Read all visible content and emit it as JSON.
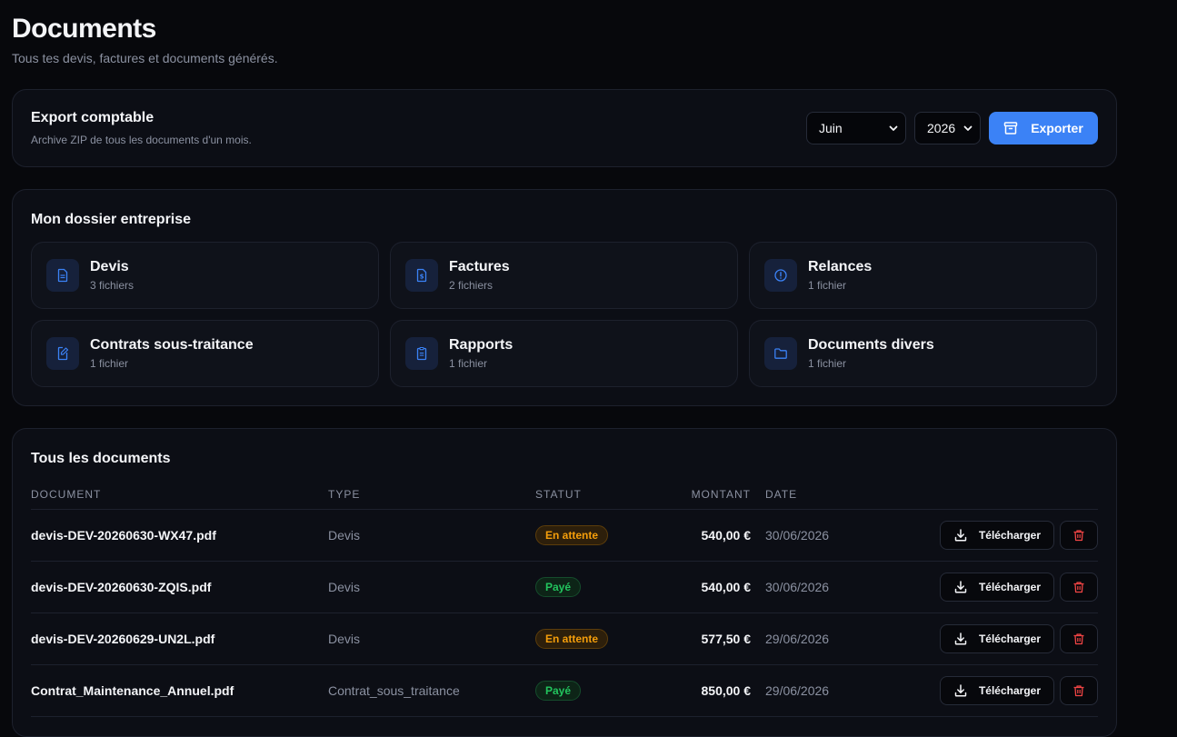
{
  "header": {
    "title": "Documents",
    "subtitle": "Tous tes devis, factures et documents générés."
  },
  "export": {
    "title": "Export comptable",
    "description": "Archive ZIP de tous les documents d'un mois.",
    "month": "Juin",
    "year": "2026",
    "button_label": "Exporter"
  },
  "folders": {
    "title": "Mon dossier entreprise",
    "items": [
      {
        "name": "Devis",
        "count": "3 fichiers",
        "icon": "file-text-icon"
      },
      {
        "name": "Factures",
        "count": "2 fichiers",
        "icon": "invoice-dollar-icon"
      },
      {
        "name": "Relances",
        "count": "1 fichier",
        "icon": "alert-circle-icon"
      },
      {
        "name": "Contrats sous-traitance",
        "count": "1 fichier",
        "icon": "file-edit-icon"
      },
      {
        "name": "Rapports",
        "count": "1 fichier",
        "icon": "clipboard-icon"
      },
      {
        "name": "Documents divers",
        "count": "1 fichier",
        "icon": "folder-icon"
      }
    ]
  },
  "documents": {
    "title": "Tous les documents",
    "columns": {
      "document": "DOCUMENT",
      "type": "TYPE",
      "status": "STATUT",
      "amount": "MONTANT",
      "date": "DATE"
    },
    "download_label": "Télécharger",
    "rows": [
      {
        "name": "devis-DEV-20260630-WX47.pdf",
        "type": "Devis",
        "status": "En attente",
        "status_kind": "pending",
        "amount": "540,00 €",
        "date": "30/06/2026"
      },
      {
        "name": "devis-DEV-20260630-ZQIS.pdf",
        "type": "Devis",
        "status": "Payé",
        "status_kind": "paid",
        "amount": "540,00 €",
        "date": "30/06/2026"
      },
      {
        "name": "devis-DEV-20260629-UN2L.pdf",
        "type": "Devis",
        "status": "En attente",
        "status_kind": "pending",
        "amount": "577,50 €",
        "date": "29/06/2026"
      },
      {
        "name": "Contrat_Maintenance_Annuel.pdf",
        "type": "Contrat_sous_traitance",
        "status": "Payé",
        "status_kind": "paid",
        "amount": "850,00 €",
        "date": "29/06/2026"
      }
    ]
  },
  "colors": {
    "accent": "#3b82f6",
    "pending": "#f59e0b",
    "paid": "#22c55e",
    "danger": "#ef4444"
  }
}
